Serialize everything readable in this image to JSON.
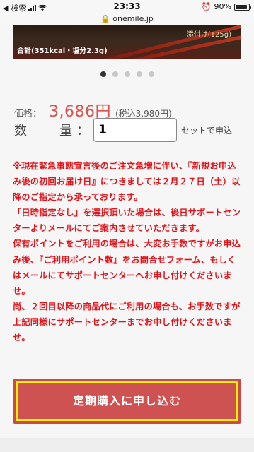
{
  "status_bar": {
    "carrier": "検索",
    "time": "23:33",
    "battery": "90%",
    "battery_level": 0.9
  },
  "url_bar": {
    "domain": "onemile.jp"
  },
  "product_image": {
    "label": "添付け(125g)",
    "nutrition": "合計(351kcal・塩分2.3g)"
  },
  "carousel": {
    "count": 5,
    "active_index": 0
  },
  "price": {
    "label": "価格：",
    "value": "3,686円",
    "tax_included": "(税込3,980円)"
  },
  "quantity": {
    "label": "数　量",
    "colon": "：",
    "value": "1",
    "suffix": "セットで申込"
  },
  "notice": {
    "p1": "※現在緊急事態宣言後のご注文急増に伴い、『新規お申込み後の初回お届け日』につきましては２月２７日（土）以降のご指定から承っております。",
    "p2": "「日時指定なし」を選択頂いた場合は、後日サポートセンターよりメールにてご案内させていただきます。",
    "p3": "保有ポイントをご利用の場合は、大変お手数ですがお申込み後、『ご利用ポイント数』をお問合せフォーム、もしくはメールにてサポートセンターへお申し付けくださいませ。",
    "p4": "尚、２回目以降の商品代にご利用の場合も、お手数ですが上記同様にサポートセンターまでお申し付けくださいませ。"
  },
  "cta": {
    "label": "定期購入に申し込む"
  },
  "colors": {
    "accent_red": "#d9534f",
    "notice_red": "#e0141b",
    "button": "#cf5252",
    "highlight": "#f5f000"
  }
}
